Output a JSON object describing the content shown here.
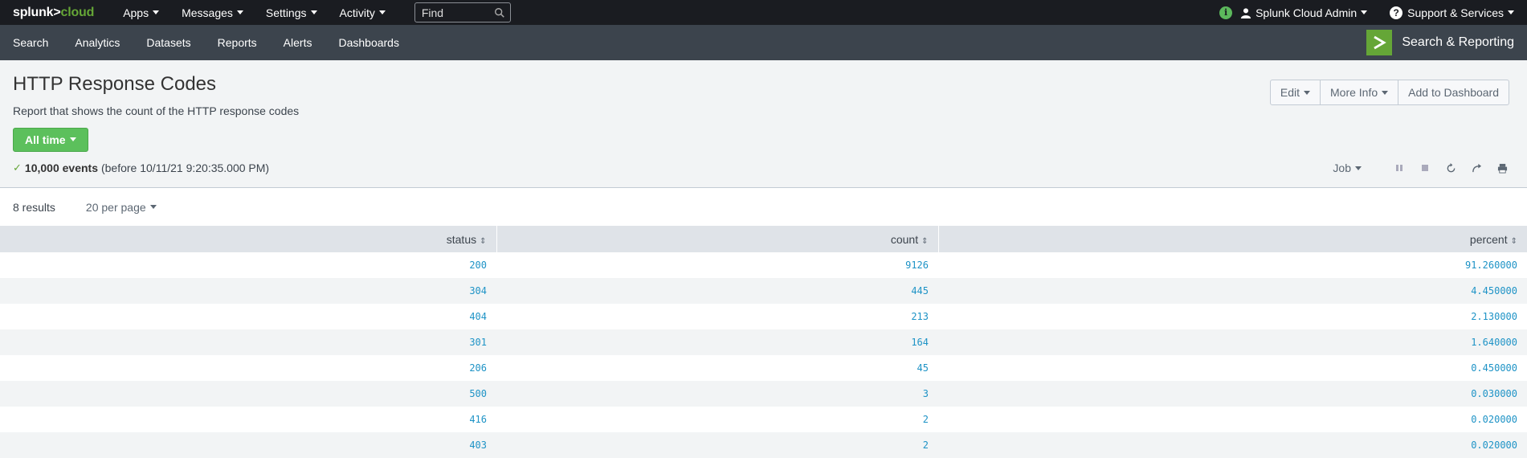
{
  "brand": {
    "part1": "splunk>",
    "part2": "cloud"
  },
  "topnav": [
    {
      "label": "Apps"
    },
    {
      "label": "Messages"
    },
    {
      "label": "Settings"
    },
    {
      "label": "Activity"
    }
  ],
  "find": {
    "placeholder": "Find"
  },
  "topright": {
    "user": "Splunk Cloud Admin",
    "support": "Support & Services"
  },
  "appnav": [
    "Search",
    "Analytics",
    "Datasets",
    "Reports",
    "Alerts",
    "Dashboards"
  ],
  "app_title": "Search & Reporting",
  "report": {
    "title": "HTTP Response Codes",
    "description": "Report that shows the count of the HTTP response codes",
    "time_range": "All time",
    "events_count": "10,000 events",
    "events_suffix": "(before 10/11/21 9:20:35.000 PM)"
  },
  "actions": {
    "edit": "Edit",
    "more_info": "More Info",
    "add_dashboard": "Add to Dashboard"
  },
  "job": {
    "label": "Job"
  },
  "results": {
    "count": "8 results",
    "per_page": "20 per page"
  },
  "table": {
    "columns": [
      "status",
      "count",
      "percent"
    ],
    "rows": [
      [
        "200",
        "9126",
        "91.260000"
      ],
      [
        "304",
        "445",
        "4.450000"
      ],
      [
        "404",
        "213",
        "2.130000"
      ],
      [
        "301",
        "164",
        "1.640000"
      ],
      [
        "206",
        "45",
        "0.450000"
      ],
      [
        "500",
        "3",
        "0.030000"
      ],
      [
        "416",
        "2",
        "0.020000"
      ],
      [
        "403",
        "2",
        "0.020000"
      ]
    ]
  },
  "colors": {
    "accent_green": "#65a637",
    "link_blue": "#1e93c6"
  }
}
